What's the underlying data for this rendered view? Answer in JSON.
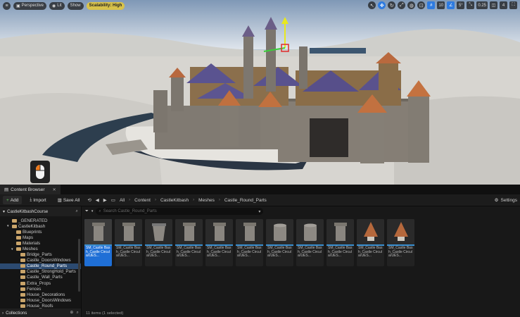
{
  "viewport": {
    "perspective_label": "Perspective",
    "lit_label": "Lit",
    "show_label": "Show",
    "scalability_label": "Scalability: High",
    "grid_snap_value": "10",
    "rotation_snap_value": "5°",
    "scale_snap_value": "0.25",
    "camera_speed_value": "4"
  },
  "content_browser": {
    "tab_label": "Content Browser",
    "add_label": "Add",
    "import_label": "Import",
    "save_all_label": "Save All",
    "breadcrumb": [
      "All",
      "Content",
      "CastleKitbash",
      "Meshes",
      "Castle_Round_Parts"
    ],
    "settings_label": "Settings",
    "search_placeholder": "Search Castle_Round_Parts",
    "tree_root": "CastleKitbashCourse",
    "tree": [
      {
        "label": "_GENERATED",
        "indent": 1
      },
      {
        "label": "CastleKitbash",
        "indent": 1
      },
      {
        "label": "Blueprints",
        "indent": 2
      },
      {
        "label": "Maps",
        "indent": 2
      },
      {
        "label": "Materials",
        "indent": 2
      },
      {
        "label": "Meshes",
        "indent": 2
      },
      {
        "label": "Bridge_Parts",
        "indent": 3
      },
      {
        "label": "Castle_DoorsWindows",
        "indent": 3
      },
      {
        "label": "Castle_Round_Parts",
        "indent": 3,
        "selected": true
      },
      {
        "label": "Castle_StrongHold_Parts",
        "indent": 3
      },
      {
        "label": "Castle_Wall_Parts",
        "indent": 3
      },
      {
        "label": "Extra_Props",
        "indent": 3
      },
      {
        "label": "Fences",
        "indent": 3
      },
      {
        "label": "House_Decorations",
        "indent": 3
      },
      {
        "label": "House_DoorsWindows",
        "indent": 3
      },
      {
        "label": "House_Roofs",
        "indent": 3
      }
    ],
    "collections_label": "Collections",
    "assets": [
      {
        "label": "SM_Castle Bash_Castle CircularUES...",
        "selected": true,
        "shape": "tower"
      },
      {
        "label": "SM_Castle Bash_Castle CircularUES...",
        "selected": false,
        "shape": "tower"
      },
      {
        "label": "SM_Castle Bash_Castle CircularUES...",
        "selected": false,
        "shape": "cone"
      },
      {
        "label": "SM_Castle Bash_Castle CircularUES...",
        "selected": false,
        "shape": "tower"
      },
      {
        "label": "SM_Castle Bash_Castle CircularUES...",
        "selected": false,
        "shape": "tower"
      },
      {
        "label": "SM_Castle Bash_Castle CircularUES...",
        "selected": false,
        "shape": "tower"
      },
      {
        "label": "SM_Castle Bash_Castle CircularUES...",
        "selected": false,
        "shape": "drum"
      },
      {
        "label": "SM_Castle Bash_Castle CircularUES...",
        "selected": false,
        "shape": "drum"
      },
      {
        "label": "SM_Castle Bash_Castle CircularUES...",
        "selected": false,
        "shape": "tower"
      },
      {
        "label": "SM_Castle Bash_Castle CircularUES...",
        "selected": false,
        "shape": "roof"
      },
      {
        "label": "SM_Castle Bash_Castle CircularUES...",
        "selected": false,
        "shape": "roof"
      }
    ],
    "status_text": "11 items (1 selected)"
  },
  "colors": {
    "selection_blue": "#1f6fd6",
    "scalability_yellow": "#d8c24a",
    "folder": "#c9a46a"
  }
}
